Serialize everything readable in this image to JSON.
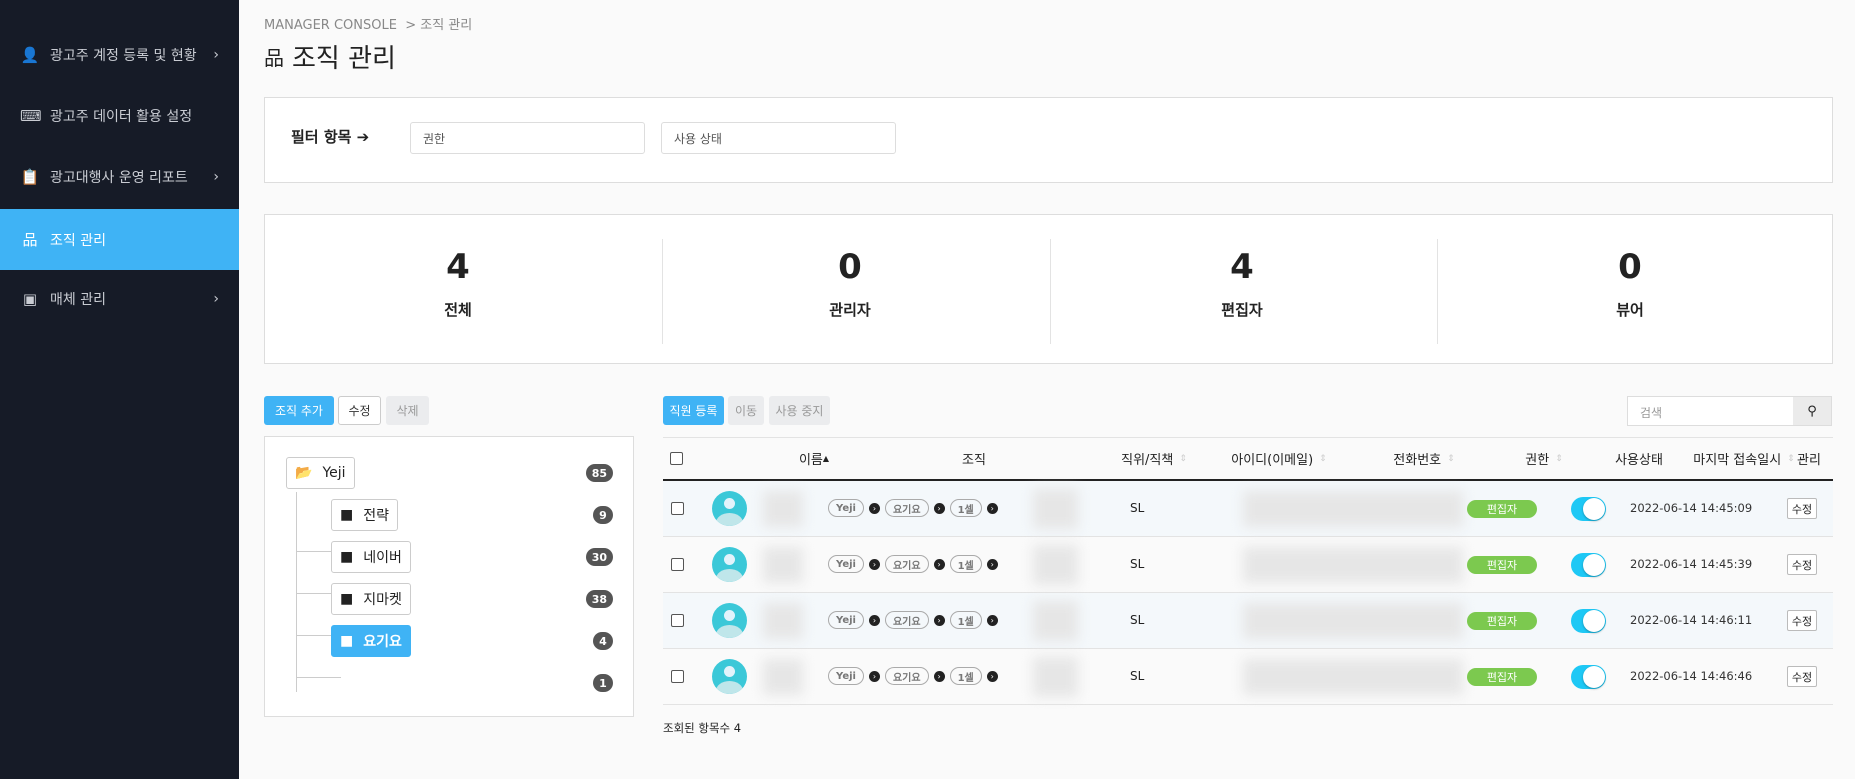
{
  "sidebar": {
    "items": [
      {
        "label": "광고주 계정 등록 및 현황",
        "icon": "user-gear-icon",
        "chevron": true
      },
      {
        "label": "광고주 데이터 활용 설정",
        "icon": "terminal-icon",
        "chevron": false
      },
      {
        "label": "광고대행사 운영 리포트",
        "icon": "clipboard-icon",
        "chevron": true
      },
      {
        "label": "조직 관리",
        "icon": "sitemap-icon",
        "chevron": false,
        "active": true
      },
      {
        "label": "매체 관리",
        "icon": "contact-card-icon",
        "chevron": true
      }
    ]
  },
  "breadcrumb": {
    "root": "MANAGER CONSOLE",
    "sep": ">",
    "current": "조직 관리"
  },
  "page_title": "조직 관리",
  "filter": {
    "label": "필터 항목",
    "fields": [
      {
        "placeholder": "권한"
      },
      {
        "placeholder": "사용 상태"
      }
    ]
  },
  "stats": [
    {
      "value": "4",
      "label": "전체"
    },
    {
      "value": "0",
      "label": "관리자"
    },
    {
      "value": "4",
      "label": "편집자"
    },
    {
      "value": "0",
      "label": "뷰어"
    }
  ],
  "tree_buttons": {
    "add": "조직 추가",
    "edit": "수정",
    "delete": "삭제"
  },
  "tree": {
    "root": {
      "label": "Yeji",
      "count": "85"
    },
    "children": [
      {
        "label": "전략",
        "count": "9"
      },
      {
        "label": "네이버",
        "count": "30"
      },
      {
        "label": "지마켓",
        "count": "38"
      },
      {
        "label": "요기요",
        "count": "4",
        "selected": true
      }
    ],
    "extra_count": "1"
  },
  "table_buttons": {
    "register": "직원 등록",
    "move": "이동",
    "suspend": "사용 중지"
  },
  "search": {
    "placeholder": "검색"
  },
  "columns": [
    "이름",
    "조직",
    "직위/직책",
    "아이디(이메일)",
    "전화번호",
    "권한",
    "사용상태",
    "마지막 접속일시",
    "관리"
  ],
  "rows": [
    {
      "org": [
        "Yeji",
        "요기요",
        "1셀"
      ],
      "position": "SL",
      "role": "편집자",
      "active": true,
      "last_login": "2022-06-14 14:45:09",
      "action": "수정"
    },
    {
      "org": [
        "Yeji",
        "요기요",
        "1셀"
      ],
      "position": "SL",
      "role": "편집자",
      "active": true,
      "last_login": "2022-06-14 14:45:39",
      "action": "수정"
    },
    {
      "org": [
        "Yeji",
        "요기요",
        "1셀"
      ],
      "position": "SL",
      "role": "편집자",
      "active": true,
      "last_login": "2022-06-14 14:46:11",
      "action": "수정"
    },
    {
      "org": [
        "Yeji",
        "요기요",
        "1셀"
      ],
      "position": "SL",
      "role": "편집자",
      "active": true,
      "last_login": "2022-06-14 14:46:46",
      "action": "수정"
    }
  ],
  "result_count": "조회된 항목수 4",
  "colors": {
    "sidebar": "#161b27",
    "accent": "#3fb3f5",
    "role_badge": "#7cc94f",
    "toggle": "#1ec8f5"
  }
}
